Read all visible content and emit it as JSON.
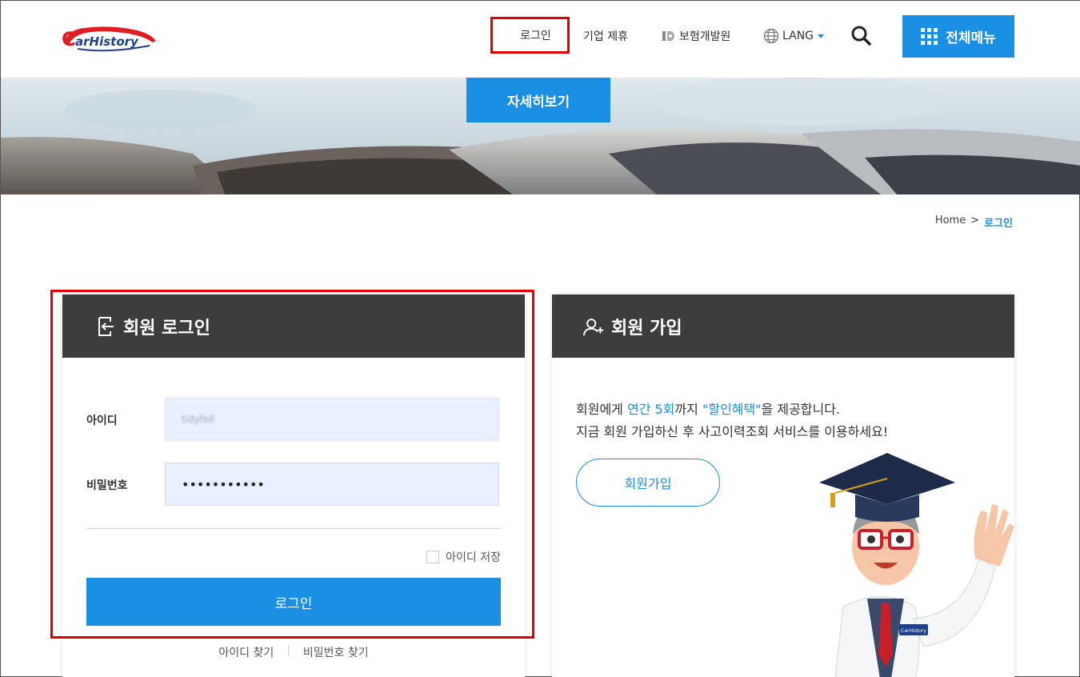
{
  "header": {
    "logo_text": "CarHistory",
    "nav": {
      "login": "로그인",
      "partner": "기업 제휴",
      "kidi": "보험개발원",
      "lang": "LANG"
    },
    "all_menu": "전체메뉴"
  },
  "banner": {
    "detail_button": "자세히보기"
  },
  "breadcrumb": {
    "home": "Home",
    "separator": ">",
    "current": "로그인"
  },
  "login_panel": {
    "title": "회원 로그인",
    "id_label": "아이디",
    "id_value": "tidyfell",
    "pw_label": "비밀번호",
    "pw_value": "•••••••••••",
    "save_id_label": "아이디 저장",
    "login_button": "로그인",
    "find_id": "아이디 찾기",
    "find_separator": "|",
    "find_pw": "비밀번호 찾기"
  },
  "join_panel": {
    "title": "회원 가입",
    "line1_pre": "회원에게 ",
    "line1_hl1": "연간 5회",
    "line1_mid": "까지 ",
    "line1_hl2": "\"할인혜택\"",
    "line1_post": "을 제공합니다.",
    "line2": "지금 회원 가입하신 후 사고이력조회 서비스를 이용하세요!",
    "join_button": "회원가입",
    "mascot_badge": "CarHistory"
  },
  "colors": {
    "accent": "#1a8fe3",
    "highlight_red": "#e30000",
    "panel_header": "#3d3d3d"
  },
  "icons": {
    "search": "search-icon",
    "globe": "globe-icon",
    "grid": "grid-icon",
    "login": "login-arrow-icon",
    "join": "user-plus-icon"
  }
}
